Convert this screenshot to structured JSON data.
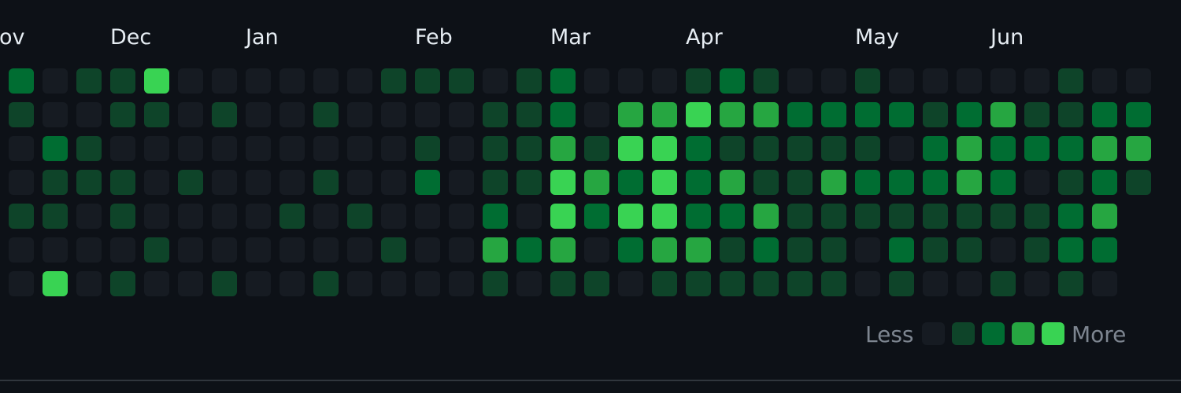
{
  "colors": {
    "background": "#0d1117",
    "levels": [
      "#161b22",
      "#0e4429",
      "#006d32",
      "#26a641",
      "#39d353"
    ]
  },
  "months": [
    {
      "label": "ov",
      "week": 0
    },
    {
      "label": "Dec",
      "week": 3
    },
    {
      "label": "Jan",
      "week": 7
    },
    {
      "label": "Feb",
      "week": 12
    },
    {
      "label": "Mar",
      "week": 16
    },
    {
      "label": "Apr",
      "week": 20
    },
    {
      "label": "May",
      "week": 25
    },
    {
      "label": "Jun",
      "week": 29
    }
  ],
  "contributions": [
    [
      2,
      1,
      0,
      0,
      1,
      0,
      0
    ],
    [
      0,
      0,
      2,
      1,
      1,
      0,
      4
    ],
    [
      1,
      0,
      1,
      1,
      0,
      0,
      0
    ],
    [
      1,
      1,
      0,
      1,
      1,
      0,
      1
    ],
    [
      4,
      1,
      0,
      0,
      0,
      1,
      0
    ],
    [
      0,
      0,
      0,
      1,
      0,
      0,
      0
    ],
    [
      0,
      1,
      0,
      0,
      0,
      0,
      1
    ],
    [
      0,
      0,
      0,
      0,
      0,
      0,
      0
    ],
    [
      0,
      0,
      0,
      0,
      1,
      0,
      0
    ],
    [
      0,
      1,
      0,
      1,
      0,
      0,
      1
    ],
    [
      0,
      0,
      0,
      0,
      1,
      0,
      0
    ],
    [
      1,
      0,
      0,
      0,
      0,
      1,
      0
    ],
    [
      1,
      0,
      1,
      2,
      0,
      0,
      0
    ],
    [
      1,
      0,
      0,
      0,
      0,
      0,
      0
    ],
    [
      0,
      1,
      1,
      1,
      2,
      3,
      1
    ],
    [
      1,
      1,
      1,
      1,
      0,
      2,
      0
    ],
    [
      2,
      2,
      3,
      4,
      4,
      3,
      1
    ],
    [
      0,
      0,
      1,
      3,
      2,
      0,
      1
    ],
    [
      0,
      3,
      4,
      2,
      4,
      2,
      0
    ],
    [
      0,
      3,
      4,
      4,
      4,
      3,
      1
    ],
    [
      1,
      4,
      2,
      2,
      2,
      3,
      1
    ],
    [
      2,
      3,
      1,
      3,
      2,
      1,
      1
    ],
    [
      1,
      3,
      1,
      1,
      3,
      2,
      1
    ],
    [
      0,
      2,
      1,
      1,
      1,
      1,
      1
    ],
    [
      0,
      2,
      1,
      3,
      1,
      1,
      1
    ],
    [
      1,
      2,
      1,
      2,
      1,
      0,
      0
    ],
    [
      0,
      2,
      0,
      2,
      1,
      2,
      1
    ],
    [
      0,
      1,
      2,
      2,
      1,
      1,
      0
    ],
    [
      0,
      2,
      3,
      3,
      1,
      1,
      0
    ],
    [
      0,
      3,
      2,
      2,
      1,
      0,
      1
    ],
    [
      0,
      1,
      2,
      0,
      1,
      1,
      0
    ],
    [
      1,
      1,
      2,
      1,
      2,
      2,
      1
    ],
    [
      0,
      2,
      3,
      2,
      3,
      2,
      0
    ],
    [
      0,
      2,
      3,
      1,
      null,
      null,
      null
    ]
  ],
  "legend": {
    "less_label": "Less",
    "more_label": "More",
    "levels": [
      0,
      1,
      2,
      3,
      4
    ]
  }
}
